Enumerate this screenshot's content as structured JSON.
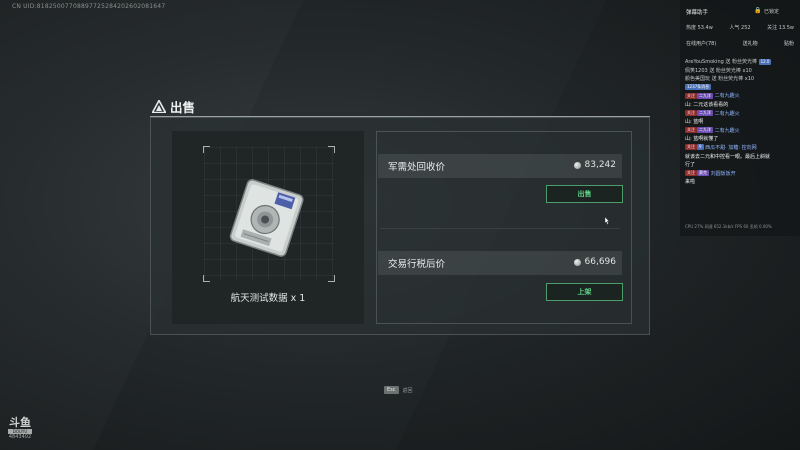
{
  "uid": "CN UID:818250077088977252842026020816​47",
  "dialog": {
    "title": "出售",
    "item_name": "航天测试数据 x 1",
    "rows": [
      {
        "label": "军需处回收价",
        "value": "83,242",
        "button": "出售"
      },
      {
        "label": "交易行税后价",
        "value": "66,696",
        "button": "上架"
      }
    ]
  },
  "footer": {
    "esc_key": "Esc",
    "esc_label": "返回"
  },
  "logo": {
    "mark": "斗鱼",
    "line1": "DOUYU",
    "line2": "4843402"
  },
  "stream_panel": {
    "title": "弹幕助手",
    "locked": "已锁定",
    "stats": [
      "热度 53.4w",
      "人气 252",
      "关注 13.5w"
    ],
    "tabs": [
      "在线用户(78)",
      "送礼物",
      "贴粉"
    ],
    "chat": [
      {
        "parts": [
          {
            "t": "AreYouSmoking 送 粉丝荧光棒 ",
            "c": "plain"
          },
          {
            "t": "12.0",
            "c": "tag blue"
          }
        ]
      },
      {
        "parts": [
          {
            "t": "佩笑1203 送 粉丝荧光棒  x10",
            "c": "plain"
          }
        ]
      },
      {
        "parts": [
          {
            "t": "颜色美国玩 送 粉丝荧光棒  x10",
            "c": "plain"
          }
        ]
      },
      {
        "parts": [
          {
            "t": "1237条消息",
            "c": "tag blue"
          }
        ]
      },
      {
        "parts": [
          {
            "t": "关注",
            "c": "tag red"
          },
          {
            "t": " 二九洋 ",
            "c": "tag purple"
          },
          {
            "t": " 二有九趣火",
            "c": "name"
          }
        ]
      },
      {
        "parts": [
          {
            "t": "山: 二元这该看看的",
            "c": "msg"
          }
        ]
      },
      {
        "parts": [
          {
            "t": "关注",
            "c": "tag red"
          },
          {
            "t": " 二九洋 ",
            "c": "tag purple"
          },
          {
            "t": " 二有九趣火",
            "c": "name"
          }
        ]
      },
      {
        "parts": [
          {
            "t": "山: 蓝啊",
            "c": "msg"
          }
        ]
      },
      {
        "parts": [
          {
            "t": "关注",
            "c": "tag red"
          },
          {
            "t": " 二九洋 ",
            "c": "tag purple"
          },
          {
            "t": " 二有九趣火",
            "c": "name"
          }
        ]
      },
      {
        "parts": [
          {
            "t": "山: 蓝啊就懂了",
            "c": "msg"
          }
        ]
      },
      {
        "parts": [
          {
            "t": "关注",
            "c": "tag red"
          },
          {
            "t": " 9 ",
            "c": "tag blue"
          },
          {
            "t": " 西瓜不甜· 加糖: 控向网",
            "c": "name"
          }
        ]
      },
      {
        "parts": [
          {
            "t": "就该去二元和中控看一眼。最后上斜就",
            "c": "msg"
          }
        ]
      },
      {
        "parts": [
          {
            "t": "行了",
            "c": "msg"
          }
        ]
      },
      {
        "parts": [
          {
            "t": "关注",
            "c": "tag red"
          },
          {
            "t": " 赛克 ",
            "c": "tag purple"
          },
          {
            "t": " 刘圆饭饭开",
            "c": "name"
          }
        ]
      },
      {
        "parts": [
          {
            "t": "来啦",
            "c": "msg"
          }
        ]
      }
    ],
    "perf": "CPU 27%  网速 652.1kb/s  FPS 60  丢帧 0.00%"
  },
  "colors": {
    "accent_green": "#5fd38a",
    "button_border": "#4e9c6a"
  }
}
